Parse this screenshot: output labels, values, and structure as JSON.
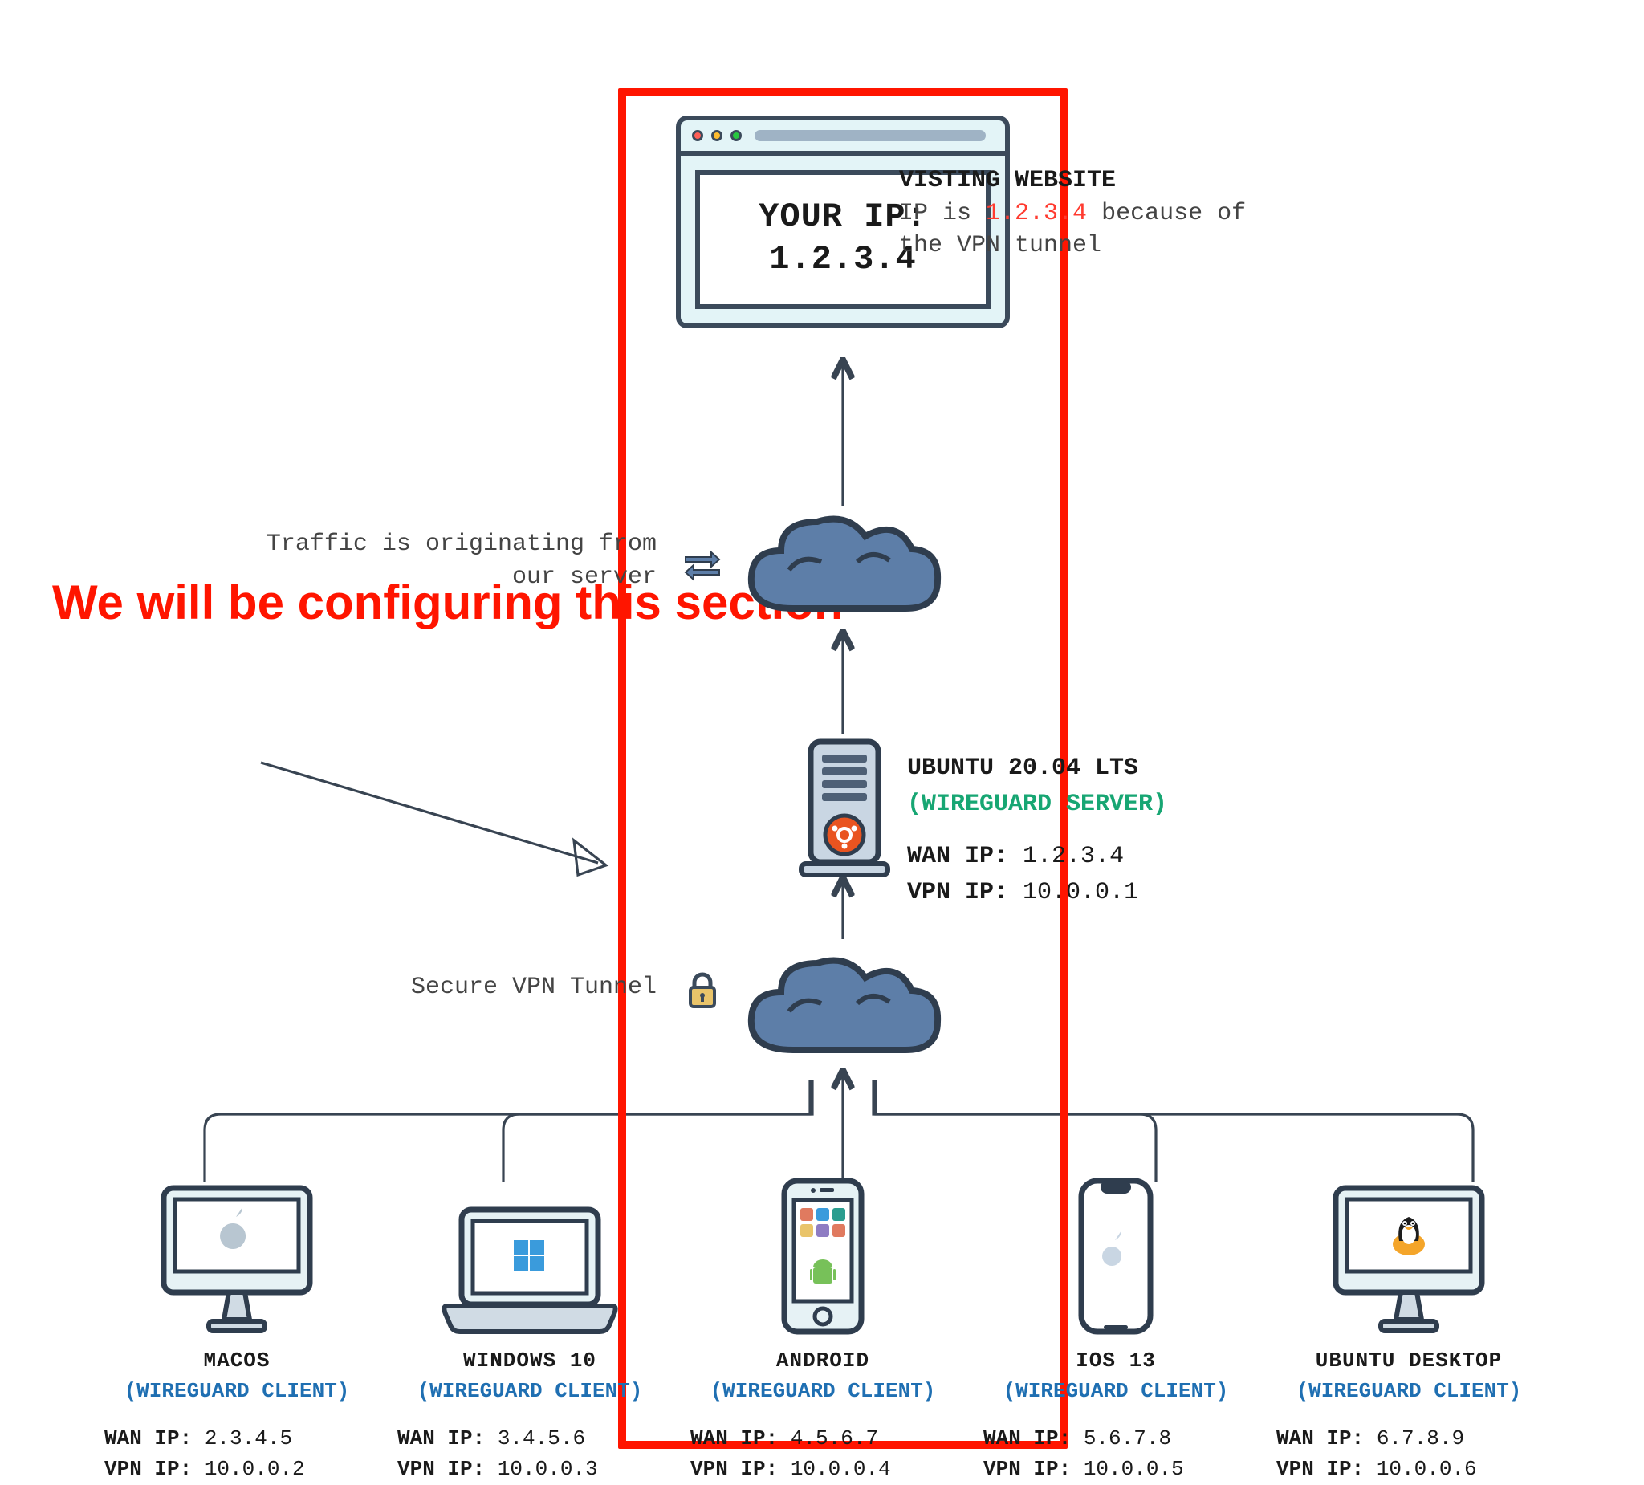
{
  "browser": {
    "line1": "YOUR IP:",
    "line2": "1.2.3.4"
  },
  "visiting": {
    "title": "VISTING WEBSITE",
    "prefix": "IP is ",
    "ip": "1.2.3.4",
    "suffix": " because of the VPN tunnel"
  },
  "traffic_label": "Traffic is originating from our server",
  "tunnel_label": "Secure VPN Tunnel",
  "server": {
    "title": "UBUNTU 20.04 LTS",
    "sub": "(WIREGUARD SERVER)",
    "wan_label": "WAN IP:",
    "wan": "1.2.3.4",
    "vpn_label": "VPN IP:",
    "vpn": "10.0.0.1"
  },
  "callout": "We will be configuring this section",
  "clients": [
    {
      "name": "MACOS",
      "sub": "(WIREGUARD CLIENT)",
      "wan_label": "WAN IP:",
      "wan": "2.3.4.5",
      "vpn_label": "VPN IP:",
      "vpn": "10.0.0.2"
    },
    {
      "name": "WINDOWS 10",
      "sub": "(WIREGUARD CLIENT)",
      "wan_label": "WAN IP:",
      "wan": "3.4.5.6",
      "vpn_label": "VPN IP:",
      "vpn": "10.0.0.3"
    },
    {
      "name": "ANDROID",
      "sub": "(WIREGUARD CLIENT)",
      "wan_label": "WAN IP:",
      "wan": "4.5.6.7",
      "vpn_label": "VPN IP:",
      "vpn": "10.0.0.4"
    },
    {
      "name": "IOS 13",
      "sub": "(WIREGUARD CLIENT)",
      "wan_label": "WAN IP:",
      "wan": "5.6.7.8",
      "vpn_label": "VPN IP:",
      "vpn": "10.0.0.5"
    },
    {
      "name": "UBUNTU DESKTOP",
      "sub": "(WIREGUARD CLIENT)",
      "wan_label": "WAN IP:",
      "wan": "6.7.8.9",
      "vpn_label": "VPN IP:",
      "vpn": "10.0.0.6"
    }
  ]
}
